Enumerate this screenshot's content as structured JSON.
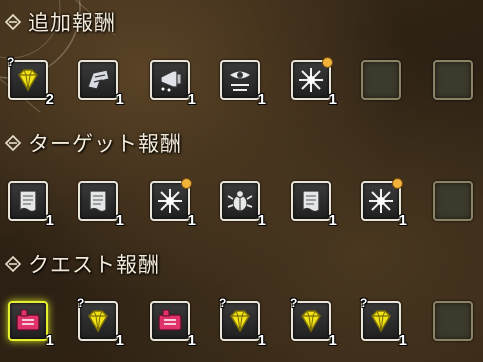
{
  "sections": [
    {
      "title": "追加報酬",
      "items": [
        {
          "icon": "gem-icon",
          "count": "2",
          "unknown_mark": "?"
        },
        {
          "icon": "armor-piece-icon",
          "count": "1"
        },
        {
          "icon": "horn-icon",
          "count": "1"
        },
        {
          "icon": "eye-scroll-icon",
          "count": "1"
        },
        {
          "icon": "spark-icon",
          "count": "1",
          "badge": true
        },
        {
          "icon": "empty-slot",
          "count": ""
        },
        {
          "icon": "empty-slot",
          "count": ""
        }
      ]
    },
    {
      "title": "ターゲット報酬",
      "items": [
        {
          "icon": "scroll-icon",
          "count": "1"
        },
        {
          "icon": "scroll-icon",
          "count": "1"
        },
        {
          "icon": "spark-icon",
          "count": "1",
          "badge": true
        },
        {
          "icon": "bug-icon",
          "count": "1"
        },
        {
          "icon": "scroll-icon",
          "count": "1"
        },
        {
          "icon": "spark-icon",
          "count": "1",
          "badge": true
        },
        {
          "icon": "empty-slot",
          "count": ""
        }
      ]
    },
    {
      "title": "クエスト報酬",
      "items": [
        {
          "icon": "ticket-icon",
          "count": "1",
          "highlight": true
        },
        {
          "icon": "gem-icon",
          "count": "1",
          "unknown_mark": "?"
        },
        {
          "icon": "ticket-icon",
          "count": "1"
        },
        {
          "icon": "gem-icon",
          "count": "1",
          "unknown_mark": "?"
        },
        {
          "icon": "gem-icon",
          "count": "1",
          "unknown_mark": "?"
        },
        {
          "icon": "gem-icon",
          "count": "1",
          "unknown_mark": "?"
        },
        {
          "icon": "empty-slot",
          "count": ""
        }
      ]
    }
  ],
  "colors": {
    "gem": "#f1e21a",
    "ticket": "#e0336a",
    "slot_border": "#e9e4d8",
    "empty_slot": "#3c3a2c",
    "badge": "#f2b33a"
  }
}
